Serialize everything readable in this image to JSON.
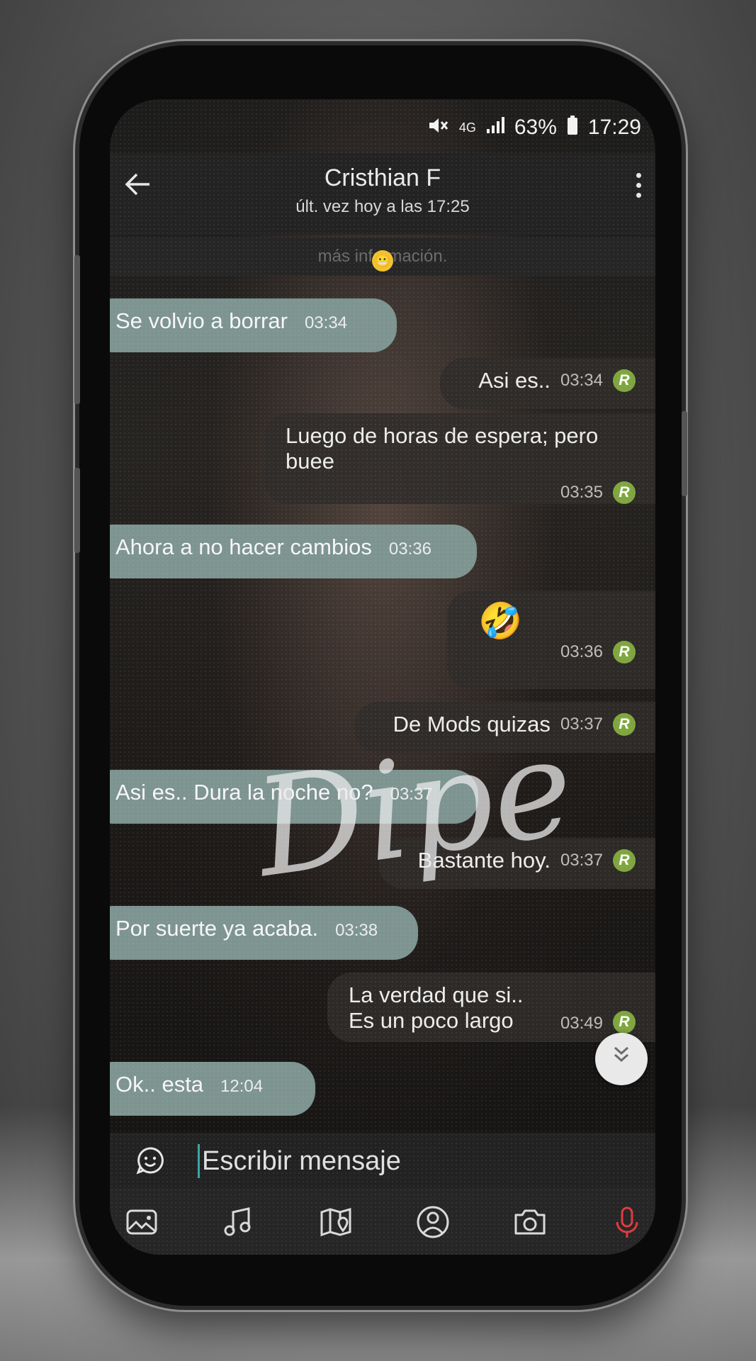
{
  "status_bar": {
    "mute_icon": "mute-icon",
    "network": "4G",
    "battery": "63%",
    "time": "17:29"
  },
  "header": {
    "contact_name": "Cristhian F",
    "last_seen": "últ. vez hoy a las 17:25"
  },
  "info_banner": "más información.",
  "messages": [
    {
      "dir": "in",
      "text": "Se volvio a borrar",
      "time": "03:34"
    },
    {
      "dir": "out",
      "text": "Asi es..",
      "time": "03:34",
      "badge": "R"
    },
    {
      "dir": "out",
      "text": "Luego de horas de espera; pero buee",
      "time": "03:35",
      "badge": "R"
    },
    {
      "dir": "in",
      "text": "Ahora a no hacer cambios",
      "time": "03:36"
    },
    {
      "dir": "out",
      "text": "🤣",
      "time": "03:36",
      "badge": "R"
    },
    {
      "dir": "out",
      "text": "De Mods  quizas",
      "time": "03:37",
      "badge": "R"
    },
    {
      "dir": "in",
      "text": "Asi es..  Dura la noche no?",
      "time": "03:37"
    },
    {
      "dir": "out",
      "text": "Bastante hoy.",
      "time": "03:37",
      "badge": "R"
    },
    {
      "dir": "in",
      "text": "Por suerte ya acaba.",
      "time": "03:38"
    },
    {
      "dir": "out",
      "line1": "La verdad que si..",
      "line2": "Es un poco largo",
      "time": "03:49",
      "badge": "R"
    },
    {
      "dir": "in",
      "text": "Ok.. esta",
      "time": "12:04"
    }
  ],
  "watermark": "Dipe",
  "composer": {
    "placeholder": "Escribir mensaje"
  },
  "toolbar_icons": [
    "gallery-icon",
    "music-icon",
    "map-icon",
    "contact-icon",
    "camera-icon",
    "microphone-icon"
  ],
  "colors": {
    "incoming_bubble": "#7d9490",
    "badge": "#7fa63e",
    "cursor": "#3aa4a6",
    "mic": "#e0393e"
  }
}
